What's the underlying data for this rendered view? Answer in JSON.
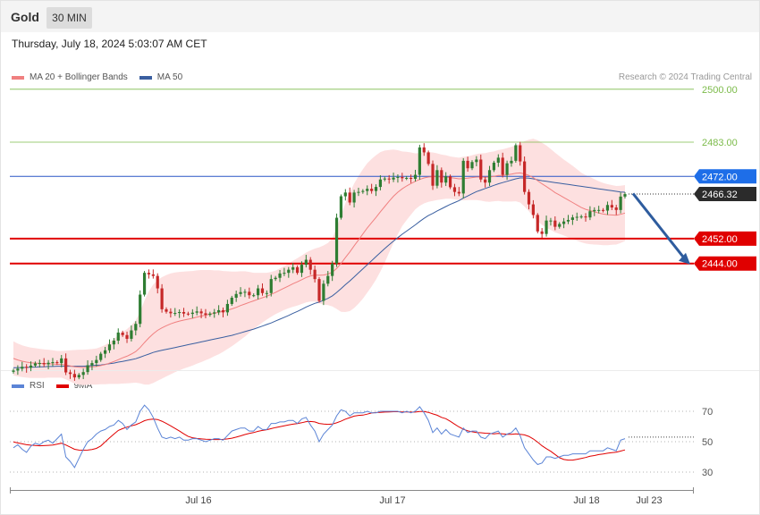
{
  "header": {
    "instrument": "Gold",
    "timeframe": "30 MIN"
  },
  "datetime": "Thursday, July 18, 2024 5:03:07 AM CET",
  "legend": {
    "main": [
      {
        "label": "MA 20 + Bollinger Bands",
        "color": "#f08080"
      },
      {
        "label": "MA 50",
        "color": "#3a5fa0"
      }
    ],
    "rsi": [
      {
        "label": "RSI",
        "color": "#5b84d6"
      },
      {
        "label": "9MA",
        "color": "#e00000"
      }
    ]
  },
  "copyright": "Research © 2024 Trading Central",
  "colors": {
    "bull": "#2e7d32",
    "bear": "#c62828",
    "resistance": "#e00000",
    "target": "#7cbb4a",
    "pivot": "#2a56c6",
    "arrow": "#2e5c9e",
    "bband": "#fde0e0"
  },
  "chart_data": [
    {
      "type": "candlestick",
      "title": "Gold 30 MIN",
      "x_tick_labels": [
        "Jul 16",
        "Jul 17",
        "Jul 18",
        "Jul 23"
      ],
      "y_range": [
        2408,
        2510
      ],
      "levels": [
        {
          "label": "2500.00",
          "value": 2500.0,
          "kind": "target"
        },
        {
          "label": "2483.00",
          "value": 2483.0,
          "kind": "target"
        },
        {
          "label": "2472.00",
          "value": 2472.0,
          "kind": "pivot"
        },
        {
          "label": "2466.32",
          "value": 2466.32,
          "kind": "last"
        },
        {
          "label": "2452.00",
          "value": 2452.0,
          "kind": "support"
        },
        {
          "label": "2444.00",
          "value": 2444.0,
          "kind": "support"
        }
      ],
      "forecast_arrow": {
        "from": 2466.5,
        "to": 2444.0
      },
      "closes": [
        2409.6,
        2410.2,
        2410.8,
        2410.5,
        2411.2,
        2411.9,
        2412.0,
        2411.6,
        2412.1,
        2412.3,
        2412.0,
        2413.5,
        2409.0,
        2408.5,
        2407.4,
        2408.2,
        2409.1,
        2411.3,
        2412.0,
        2413.0,
        2415.0,
        2416.1,
        2418.0,
        2419.2,
        2421.8,
        2421.0,
        2419.8,
        2422.5,
        2424.6,
        2434.0,
        2441.0,
        2440.5,
        2440.0,
        2436.0,
        2429.3,
        2428.5,
        2428.0,
        2428.1,
        2428.4,
        2427.9,
        2427.8,
        2428.2,
        2428.6,
        2428.0,
        2427.5,
        2427.9,
        2428.3,
        2429.0,
        2428.3,
        2431.0,
        2433.0,
        2434.2,
        2434.8,
        2434.9,
        2433.8,
        2433.8,
        2436.0,
        2434.5,
        2434.5,
        2439.0,
        2439.4,
        2440.8,
        2441.0,
        2442.0,
        2442.8,
        2441.0,
        2443.6,
        2445.2,
        2442.0,
        2439.0,
        2432.0,
        2437.5,
        2440.0,
        2444.0,
        2458.7,
        2465.6,
        2466.8,
        2463.6,
        2466.8,
        2467.0,
        2467.3,
        2468.0,
        2467.3,
        2468.6,
        2471.0,
        2471.3,
        2471.0,
        2471.6,
        2471.8,
        2471.4,
        2471.5,
        2471.2,
        2472.5,
        2481.3,
        2479.7,
        2476.0,
        2469.0,
        2474.0,
        2470.0,
        2472.0,
        2468.5,
        2467.0,
        2466.5,
        2477.0,
        2474.6,
        2476.6,
        2477.4,
        2471.0,
        2470.0,
        2474.0,
        2476.4,
        2478.0,
        2472.5,
        2476.2,
        2477.0,
        2482.0,
        2476.8,
        2467.0,
        2463.0,
        2459.6,
        2454.3,
        2453.5,
        2457.8,
        2457.8,
        2455.8,
        2456.7,
        2457.5,
        2458.0,
        2458.8,
        2459.0,
        2459.1,
        2458.8,
        2460.8,
        2461.2,
        2461.2,
        2461.0,
        2462.8,
        2462.0,
        2461.2,
        2465.5,
        2466.3
      ],
      "ma20": [
        2413.5,
        2413.0,
        2412.6,
        2412.3,
        2412.1,
        2412.0,
        2411.9,
        2411.8,
        2411.8,
        2411.7,
        2411.6,
        2411.6,
        2411.4,
        2411.1,
        2410.8,
        2410.7,
        2410.6,
        2410.7,
        2410.8,
        2410.9,
        2411.2,
        2411.5,
        2412.0,
        2412.5,
        2413.1,
        2413.7,
        2414.2,
        2414.9,
        2415.7,
        2417.0,
        2418.6,
        2420.1,
        2421.4,
        2422.5,
        2423.3,
        2424.0,
        2424.6,
        2425.1,
        2425.5,
        2425.8,
        2426.1,
        2426.4,
        2426.8,
        2427.1,
        2427.4,
        2427.7,
        2428.0,
        2428.3,
        2428.6,
        2429.0,
        2429.4,
        2429.9,
        2430.5,
        2431.0,
        2431.5,
        2432.0,
        2432.5,
        2433.0,
        2433.5,
        2434.1,
        2434.7,
        2435.4,
        2436.1,
        2436.8,
        2437.5,
        2438.1,
        2438.8,
        2439.5,
        2440.0,
        2440.3,
        2440.2,
        2440.3,
        2440.6,
        2441.2,
        2442.4,
        2444.0,
        2445.9,
        2447.7,
        2449.7,
        2451.6,
        2453.5,
        2455.4,
        2457.1,
        2458.8,
        2460.6,
        2462.3,
        2464.0,
        2465.6,
        2466.9,
        2468.0,
        2468.9,
        2469.7,
        2470.4,
        2471.0,
        2471.5,
        2471.8,
        2471.9,
        2471.9,
        2471.8,
        2471.8,
        2471.6,
        2471.4,
        2471.2,
        2471.3,
        2471.4,
        2471.6,
        2471.8,
        2471.8,
        2471.7,
        2471.8,
        2472.0,
        2472.3,
        2472.3,
        2472.5,
        2472.7,
        2473.0,
        2473.1,
        2472.8,
        2472.3,
        2471.6,
        2470.6,
        2469.6,
        2468.7,
        2467.8,
        2466.8,
        2466.0,
        2465.2,
        2464.4,
        2463.6,
        2462.8,
        2462.0,
        2461.4,
        2461.0,
        2460.6,
        2460.2,
        2459.9,
        2459.7,
        2459.6,
        2459.5,
        2459.8,
        2460.2
      ],
      "ma50": [
        2410.5,
        2410.5,
        2410.6,
        2410.6,
        2410.7,
        2410.7,
        2410.8,
        2410.8,
        2410.9,
        2410.9,
        2411.0,
        2411.0,
        2411.0,
        2411.0,
        2411.0,
        2411.0,
        2411.0,
        2411.1,
        2411.2,
        2411.3,
        2411.4,
        2411.6,
        2411.8,
        2412.0,
        2412.3,
        2412.5,
        2412.8,
        2413.1,
        2413.4,
        2413.9,
        2414.4,
        2414.9,
        2415.4,
        2415.8,
        2416.1,
        2416.4,
        2416.7,
        2417.0,
        2417.3,
        2417.6,
        2417.9,
        2418.2,
        2418.5,
        2418.8,
        2419.1,
        2419.4,
        2419.7,
        2420.0,
        2420.3,
        2420.6,
        2420.9,
        2421.3,
        2421.7,
        2422.1,
        2422.5,
        2422.9,
        2423.4,
        2423.9,
        2424.4,
        2424.9,
        2425.5,
        2426.1,
        2426.7,
        2427.3,
        2428.0,
        2428.6,
        2429.3,
        2430.0,
        2430.6,
        2431.2,
        2431.6,
        2432.2,
        2432.8,
        2433.6,
        2434.7,
        2435.9,
        2437.2,
        2438.4,
        2439.7,
        2441.0,
        2442.3,
        2443.6,
        2444.9,
        2446.2,
        2447.5,
        2448.8,
        2450.0,
        2451.2,
        2452.3,
        2453.4,
        2454.4,
        2455.4,
        2456.4,
        2457.5,
        2458.5,
        2459.4,
        2460.1,
        2460.9,
        2461.6,
        2462.3,
        2463.0,
        2463.6,
        2464.2,
        2465.0,
        2465.7,
        2466.4,
        2467.1,
        2467.6,
        2468.1,
        2468.6,
        2469.1,
        2469.6,
        2470.0,
        2470.4,
        2470.8,
        2471.2,
        2471.5,
        2471.5,
        2471.4,
        2471.2,
        2470.9,
        2470.6,
        2470.4,
        2470.2,
        2470.0,
        2469.8,
        2469.6,
        2469.4,
        2469.2,
        2469.0,
        2468.8,
        2468.6,
        2468.4,
        2468.2,
        2468.0,
        2467.8,
        2467.6,
        2467.4,
        2467.2,
        2467.0,
        2466.9
      ],
      "bb_width": [
        5.5,
        5.3,
        5.1,
        5.0,
        4.9,
        4.8,
        4.7,
        4.6,
        4.5,
        4.4,
        4.3,
        4.3,
        4.6,
        5.0,
        5.4,
        5.6,
        5.7,
        5.7,
        5.7,
        5.8,
        6.0,
        6.3,
        6.7,
        7.2,
        7.8,
        8.3,
        8.7,
        9.3,
        10.0,
        11.5,
        13.5,
        15.0,
        15.8,
        16.2,
        16.3,
        16.3,
        16.2,
        16.0,
        15.8,
        15.6,
        15.4,
        15.2,
        15.0,
        14.8,
        14.5,
        14.2,
        13.8,
        13.5,
        13.0,
        12.5,
        12.0,
        11.5,
        11.0,
        10.5,
        9.8,
        9.0,
        8.5,
        8.0,
        7.5,
        7.2,
        7.0,
        7.0,
        7.0,
        7.2,
        7.4,
        7.6,
        7.8,
        8.0,
        8.2,
        8.5,
        9.0,
        9.5,
        10.0,
        11.0,
        13.0,
        15.5,
        17.5,
        19.0,
        20.0,
        20.5,
        20.8,
        20.8,
        20.5,
        20.0,
        19.2,
        18.0,
        16.5,
        15.0,
        13.5,
        12.0,
        11.0,
        10.0,
        9.0,
        8.5,
        8.2,
        8.0,
        7.8,
        7.5,
        7.2,
        7.0,
        6.8,
        6.8,
        6.8,
        7.0,
        7.0,
        7.2,
        7.4,
        7.6,
        7.8,
        8.0,
        8.0,
        8.2,
        8.4,
        8.6,
        8.8,
        9.0,
        9.5,
        10.5,
        11.5,
        12.5,
        13.0,
        13.2,
        13.2,
        13.0,
        12.8,
        12.5,
        12.2,
        12.0,
        11.8,
        11.5,
        11.2,
        11.0,
        10.8,
        10.5,
        10.2,
        10.0,
        9.8,
        9.6,
        9.4,
        9.2,
        9.0
      ]
    },
    {
      "type": "line",
      "title": "RSI",
      "y_range": [
        20,
        80
      ],
      "y_ticks": [
        30,
        50,
        70
      ],
      "last": 53,
      "series": [
        {
          "name": "RSI",
          "values": [
            46,
            48,
            45,
            43,
            47,
            49,
            48,
            50,
            51,
            49,
            52,
            55,
            40,
            37,
            33,
            39,
            45,
            50,
            52,
            55,
            57,
            58,
            60,
            61,
            64,
            62,
            58,
            61,
            63,
            70,
            74,
            71,
            66,
            59,
            53,
            52,
            53,
            52,
            53,
            51,
            51,
            52,
            52,
            51,
            50,
            51,
            52,
            52,
            51,
            54,
            57,
            58,
            59,
            59,
            57,
            57,
            60,
            58,
            58,
            62,
            62,
            63,
            63,
            64,
            64,
            62,
            65,
            66,
            61,
            57,
            50,
            55,
            58,
            61,
            67,
            71,
            70,
            67,
            69,
            69,
            69,
            70,
            69,
            69,
            70,
            70,
            70,
            70,
            70,
            69,
            70,
            69,
            70,
            73,
            69,
            64,
            56,
            59,
            55,
            58,
            55,
            54,
            53,
            59,
            56,
            57,
            57,
            53,
            52,
            55,
            56,
            57,
            53,
            55,
            56,
            59,
            54,
            46,
            42,
            38,
            35,
            36,
            40,
            40,
            39,
            40,
            41,
            41,
            42,
            42,
            42,
            42,
            44,
            44,
            44,
            44,
            46,
            45,
            44,
            51,
            52
          ]
        },
        {
          "name": "9MA",
          "values": [
            49.8,
            49.2,
            48.6,
            48.0,
            47.7,
            47.5,
            47.3,
            47.4,
            47.6,
            47.8,
            48.4,
            49.0,
            47.8,
            46.4,
            45.0,
            44.5,
            44.4,
            44.5,
            44.9,
            45.6,
            47.2,
            49.8,
            52.5,
            55.0,
            57.4,
            58.6,
            59.6,
            60.4,
            61.2,
            62.4,
            63.8,
            64.6,
            64.9,
            64.6,
            63.5,
            62.0,
            60.4,
            58.7,
            57.0,
            55.2,
            53.5,
            52.6,
            52.1,
            51.8,
            51.6,
            51.5,
            51.4,
            51.4,
            51.5,
            51.8,
            52.3,
            53.0,
            53.8,
            54.7,
            55.4,
            56.0,
            56.8,
            57.4,
            57.9,
            58.6,
            59.3,
            59.9,
            60.4,
            61.0,
            61.5,
            61.9,
            62.5,
            63.2,
            63.3,
            63.0,
            62.0,
            61.6,
            61.4,
            61.6,
            62.4,
            63.5,
            64.8,
            65.8,
            66.8,
            67.3,
            67.5,
            68.1,
            68.9,
            69.2,
            69.3,
            69.5,
            69.6,
            69.7,
            69.7,
            69.6,
            69.6,
            69.5,
            69.5,
            69.9,
            69.8,
            69.3,
            68.3,
            67.4,
            66.0,
            65.1,
            63.4,
            61.5,
            59.7,
            58.2,
            57.1,
            56.5,
            56.0,
            55.9,
            55.6,
            55.4,
            55.1,
            55.4,
            55.2,
            54.8,
            54.8,
            55.1,
            54.9,
            54.5,
            53.5,
            51.8,
            49.7,
            47.3,
            45.4,
            43.7,
            41.6,
            39.5,
            38.3,
            37.9,
            37.9,
            38.4,
            39.0,
            39.6,
            40.4,
            40.9,
            41.5,
            41.9,
            42.4,
            42.8,
            43.1,
            43.8,
            44.6
          ]
        }
      ]
    }
  ]
}
